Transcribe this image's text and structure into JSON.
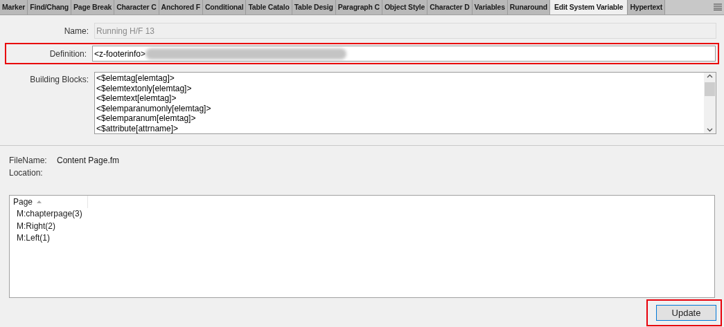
{
  "tabs": [
    {
      "label": "Marker",
      "selected": false
    },
    {
      "label": "Find/Chang",
      "selected": false
    },
    {
      "label": "Page Break",
      "selected": false
    },
    {
      "label": "Character C",
      "selected": false
    },
    {
      "label": "Anchored F",
      "selected": false
    },
    {
      "label": "Conditional",
      "selected": false
    },
    {
      "label": "Table Catalo",
      "selected": false
    },
    {
      "label": "Table Desig",
      "selected": false
    },
    {
      "label": "Paragraph C",
      "selected": false
    },
    {
      "label": "Object Style",
      "selected": false
    },
    {
      "label": "Character D",
      "selected": false
    },
    {
      "label": "Variables",
      "selected": false
    },
    {
      "label": "Runaround",
      "selected": false
    },
    {
      "label": "Edit System Variable",
      "selected": true
    },
    {
      "label": "Hypertext",
      "selected": false
    }
  ],
  "name": {
    "label": "Name:",
    "value": "Running H/F 13",
    "disabled": true
  },
  "definition": {
    "label": "Definition:",
    "value": "<z-footerinfo>",
    "redacted": true,
    "highlighted": true
  },
  "building_blocks": {
    "label": "Building Blocks:",
    "items": [
      "<$elemtag[elemtag]>",
      "<$elemtextonly[elemtag]>",
      "<$elemtext[elemtag]>",
      "<$elemparanumonly[elemtag]>",
      "<$elemparanum[elemtag]>",
      "<$attribute[attrname]>"
    ]
  },
  "file_info": [
    {
      "label": "FileName:",
      "value": "Content Page.fm"
    },
    {
      "label": "Location:"
    }
  ],
  "pages_list": {
    "column": "Page",
    "rows": [
      "M:chapterpage(3)",
      "M:Right(2)",
      "M:Left(1)"
    ]
  },
  "update_button": {
    "label": "Update",
    "highlighted": true
  }
}
